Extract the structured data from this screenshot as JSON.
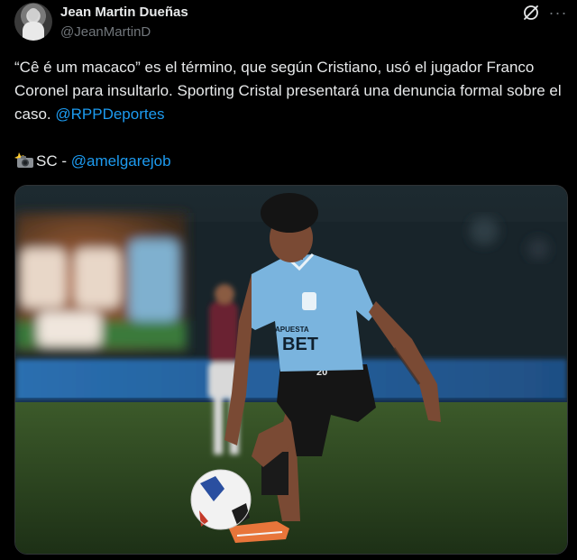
{
  "author": {
    "display_name": "Jean Martin Dueñas",
    "handle": "@JeanMartinD",
    "avatar_icon": "profile-avatar"
  },
  "header_icons": {
    "grok": "grok-icon",
    "more": "more-icon",
    "more_glyph": "···"
  },
  "tweet": {
    "text_part1": "“Cê é um macaco” es el término, que según Cristiano, usó el jugador Franco Coronel para insultarlo. Sporting Cristal presentará una denuncia formal sobre el caso. ",
    "mention_rpp": "@RPPDeportes",
    "credit_prefix": "SC - ",
    "mention_photographer": "@amelgarejob",
    "camera_icon": "camera-flash-icon"
  },
  "media": {
    "kind": "photo",
    "jersey_text": "BET",
    "jersey_sponsor_small": "APUESTA",
    "shorts_number": "20"
  },
  "colors": {
    "background": "#000000",
    "text": "#e7e9ea",
    "secondary": "#71767b",
    "link": "#1d9bf0"
  }
}
